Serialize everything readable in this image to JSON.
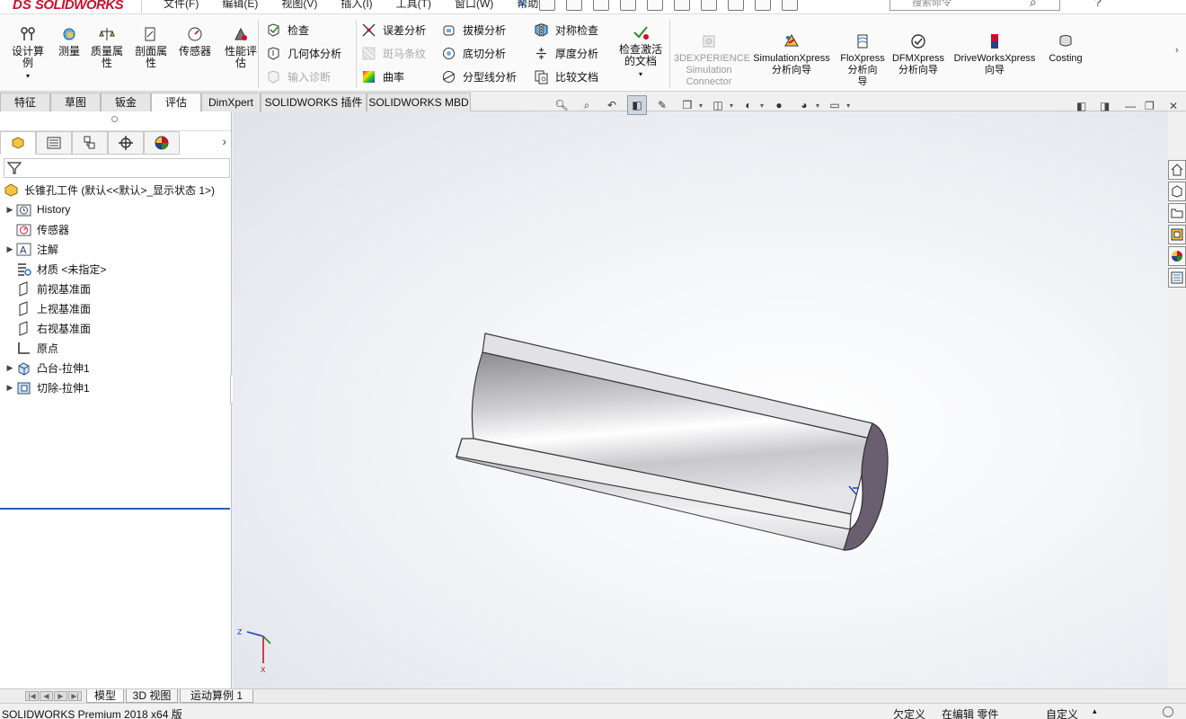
{
  "app": {
    "logo_ds": "DS",
    "logo_name": "SOLIDWORKS",
    "menus": [
      "文件(F)",
      "编辑(E)",
      "视图(V)",
      "插入(I)",
      "工具(T)",
      "窗口(W)",
      "帮助(H)"
    ],
    "search_placeholder": "搜索命令",
    "help": "?"
  },
  "ribbon": {
    "big": [
      {
        "label1": "设计算",
        "label2": "例",
        "icon": "design-study-icon"
      },
      {
        "label1": "测量",
        "label2": "",
        "icon": "measure-icon"
      },
      {
        "label1": "质量属",
        "label2": "性",
        "icon": "mass-properties-icon"
      },
      {
        "label1": "剖面属",
        "label2": "性",
        "icon": "section-properties-icon"
      },
      {
        "label1": "传感器",
        "label2": "",
        "icon": "sensor-icon"
      },
      {
        "label1": "性能评",
        "label2": "估",
        "icon": "performance-evaluation-icon"
      }
    ],
    "col1": [
      {
        "label": "检查",
        "enabled": true
      },
      {
        "label": "几何体分析",
        "enabled": true
      },
      {
        "label": "输入诊断",
        "enabled": false
      }
    ],
    "col2": [
      {
        "label": "误差分析",
        "enabled": true
      },
      {
        "label": "斑马条纹",
        "enabled": false
      },
      {
        "label": "曲率",
        "enabled": true
      }
    ],
    "col3": [
      {
        "label": "拔模分析",
        "enabled": true
      },
      {
        "label": "底切分析",
        "enabled": true
      },
      {
        "label": "分型线分析",
        "enabled": true
      }
    ],
    "col4": [
      {
        "label": "对称检查",
        "enabled": true
      },
      {
        "label": "厚度分析",
        "enabled": true
      },
      {
        "label": "比较文档",
        "enabled": true
      }
    ],
    "check_active": {
      "label1": "检查激活",
      "label2": "的文档"
    },
    "addins": [
      {
        "label1": "3DEXPERIENCE",
        "label2": "Simulation",
        "label3": "Connector",
        "enabled": false
      },
      {
        "label1": "SimulationXpress",
        "label2": "分析向导",
        "label3": "",
        "enabled": true
      },
      {
        "label1": "FloXpress",
        "label2": "分析向",
        "label3": "导",
        "enabled": true
      },
      {
        "label1": "DFMXpress",
        "label2": "分析向导",
        "label3": "",
        "enabled": true
      },
      {
        "label1": "DriveWorksXpress",
        "label2": "向导",
        "label3": "",
        "enabled": true
      },
      {
        "label1": "Costing",
        "label2": "",
        "label3": "",
        "enabled": true
      }
    ]
  },
  "tabs": [
    "特征",
    "草图",
    "钣金",
    "评估",
    "DimXpert",
    "SOLIDWORKS 插件",
    "SOLIDWORKS MBD"
  ],
  "active_tab": "评估",
  "tree": {
    "root": "长锥孔工件  (默认<<默认>_显示状态 1>)",
    "items": [
      {
        "label": "History",
        "expandable": true,
        "icon": "history-folder-icon"
      },
      {
        "label": "传感器",
        "expandable": false,
        "icon": "sensor-folder-icon"
      },
      {
        "label": "注解",
        "expandable": true,
        "icon": "annotations-icon"
      },
      {
        "label": "材质 <未指定>",
        "expandable": false,
        "icon": "material-icon"
      },
      {
        "label": "前视基准面",
        "expandable": false,
        "icon": "plane-icon"
      },
      {
        "label": "上视基准面",
        "expandable": false,
        "icon": "plane-icon"
      },
      {
        "label": "右视基准面",
        "expandable": false,
        "icon": "plane-icon"
      },
      {
        "label": "原点",
        "expandable": false,
        "icon": "origin-icon"
      },
      {
        "label": "凸台-拉伸1",
        "expandable": true,
        "icon": "boss-extrude-icon"
      },
      {
        "label": "切除-拉伸1",
        "expandable": true,
        "icon": "cut-extrude-icon"
      }
    ]
  },
  "triad": {
    "z": "Z",
    "x": "X"
  },
  "bottom_tabs": [
    "模型",
    "3D 视图",
    "运动算例 1"
  ],
  "status": {
    "product": "SOLIDWORKS Premium 2018 x64 版",
    "defined": "欠定义",
    "editing": "在编辑 零件",
    "custom": "自定义"
  },
  "colors": {
    "brand": "#c8102e",
    "accent": "#2a5db0"
  }
}
